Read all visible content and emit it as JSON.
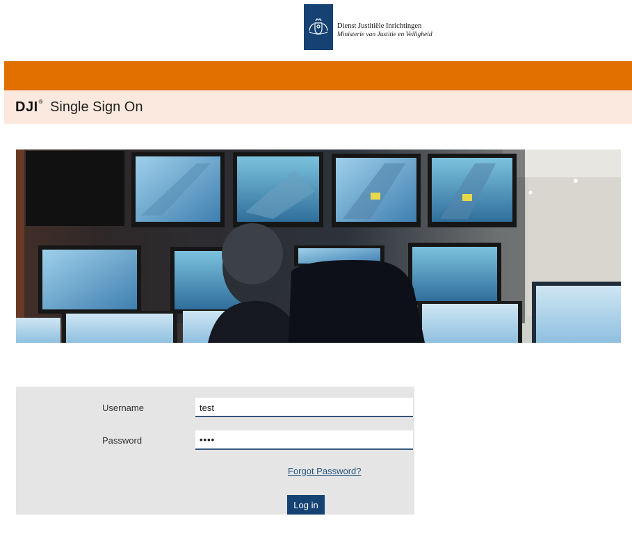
{
  "header": {
    "logo_line1": "Dienst Justitiële Inrichtingen",
    "logo_line2": "Ministerie van Justitie en Veiligheid"
  },
  "title_bar": {
    "brand": "DJI",
    "registered_mark": "®",
    "title": "Single Sign On"
  },
  "login": {
    "username_label": "Username",
    "username_value": "test",
    "password_label": "Password",
    "password_value": "••••",
    "forgot_password": "Forgot Password?",
    "login_button": "Log in"
  },
  "colors": {
    "orange_bar": "#e17000",
    "title_bar_bg": "#fbe9df",
    "rijksoverheid_blue": "#154273",
    "panel_bg": "#e5e5e5"
  },
  "icons": {
    "logo_emblem": "coat-of-arms-icon"
  }
}
